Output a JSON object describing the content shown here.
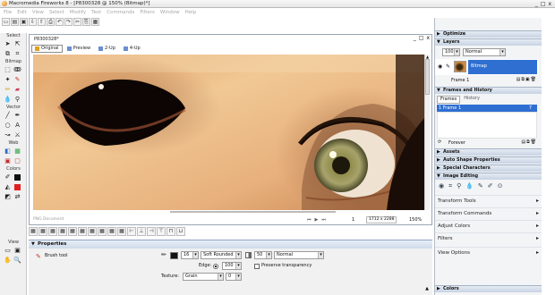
{
  "window": {
    "title": "Macromedia Fireworks 8 - [P8300328 @ 150% (Bitmap)*]",
    "controls": [
      "_",
      "□",
      "x"
    ]
  },
  "menu": [
    "File",
    "Edit",
    "View",
    "Select",
    "Modify",
    "Text",
    "Commands",
    "Filters",
    "Window",
    "Help"
  ],
  "toolbar": {
    "icons": [
      "new-file-icon",
      "open-icon",
      "save-icon",
      "import-icon",
      "export-icon",
      "print-icon",
      "undo-icon",
      "redo-icon",
      "cut-icon",
      "copy-icon",
      "paste-icon"
    ],
    "glyphs": [
      "▭",
      "▤",
      "▣",
      "⇩",
      "⇧",
      "⎙",
      "↶",
      "↷",
      "✂",
      "⎘",
      "▦"
    ]
  },
  "tools": {
    "sections": [
      "Select",
      "Bitmap",
      "Vector",
      "Web",
      "Colors",
      "View"
    ]
  },
  "document": {
    "tab": "P8300328*",
    "view_tabs": [
      "Original",
      "Preview",
      "2-Up",
      "4-Up"
    ],
    "active_view": "Original",
    "status_text": "PNG Document",
    "page_number": "1",
    "size": "1712 x 2288",
    "zoom": "150%"
  },
  "properties": {
    "title": "Properties",
    "tool_name": "Brush tool",
    "size_value": "16",
    "brush_type": "Soft Rounded",
    "opacity_value": "50",
    "blend_mode": "Normal",
    "edge_label": "Edge:",
    "edge_value": "100",
    "preserve_transparency": "Preserve transparency",
    "texture_label": "Texture:",
    "texture_value": "Grain",
    "texture_amount": "0"
  },
  "right_panels": {
    "optimize": "Optimize",
    "layers": "Layers",
    "layer_opacity": "100",
    "layer_blend": "Normal",
    "bitmap_layer_name": "Bitmap",
    "frame_label": "Frame 1",
    "frames_history": "Frames and History",
    "frames_tab": "Frames",
    "history_tab": "History",
    "frame_row": "1   Frame 1",
    "frame_delay": "7",
    "forever": "Forever",
    "assets": "Assets",
    "auto_shape": "Auto Shape Properties",
    "special_chars": "Special Characters",
    "image_editing": "Image Editing",
    "transform_tools": "Transform Tools",
    "transform_commands": "Transform Commands",
    "adjust_colors": "Adjust Colors",
    "filters": "Filters",
    "view_options": "View Options",
    "colors": "Colors"
  },
  "colors": {
    "accent": "#2f6fd1",
    "panel_header": "#cfdbea",
    "skin": "#e9b884"
  }
}
